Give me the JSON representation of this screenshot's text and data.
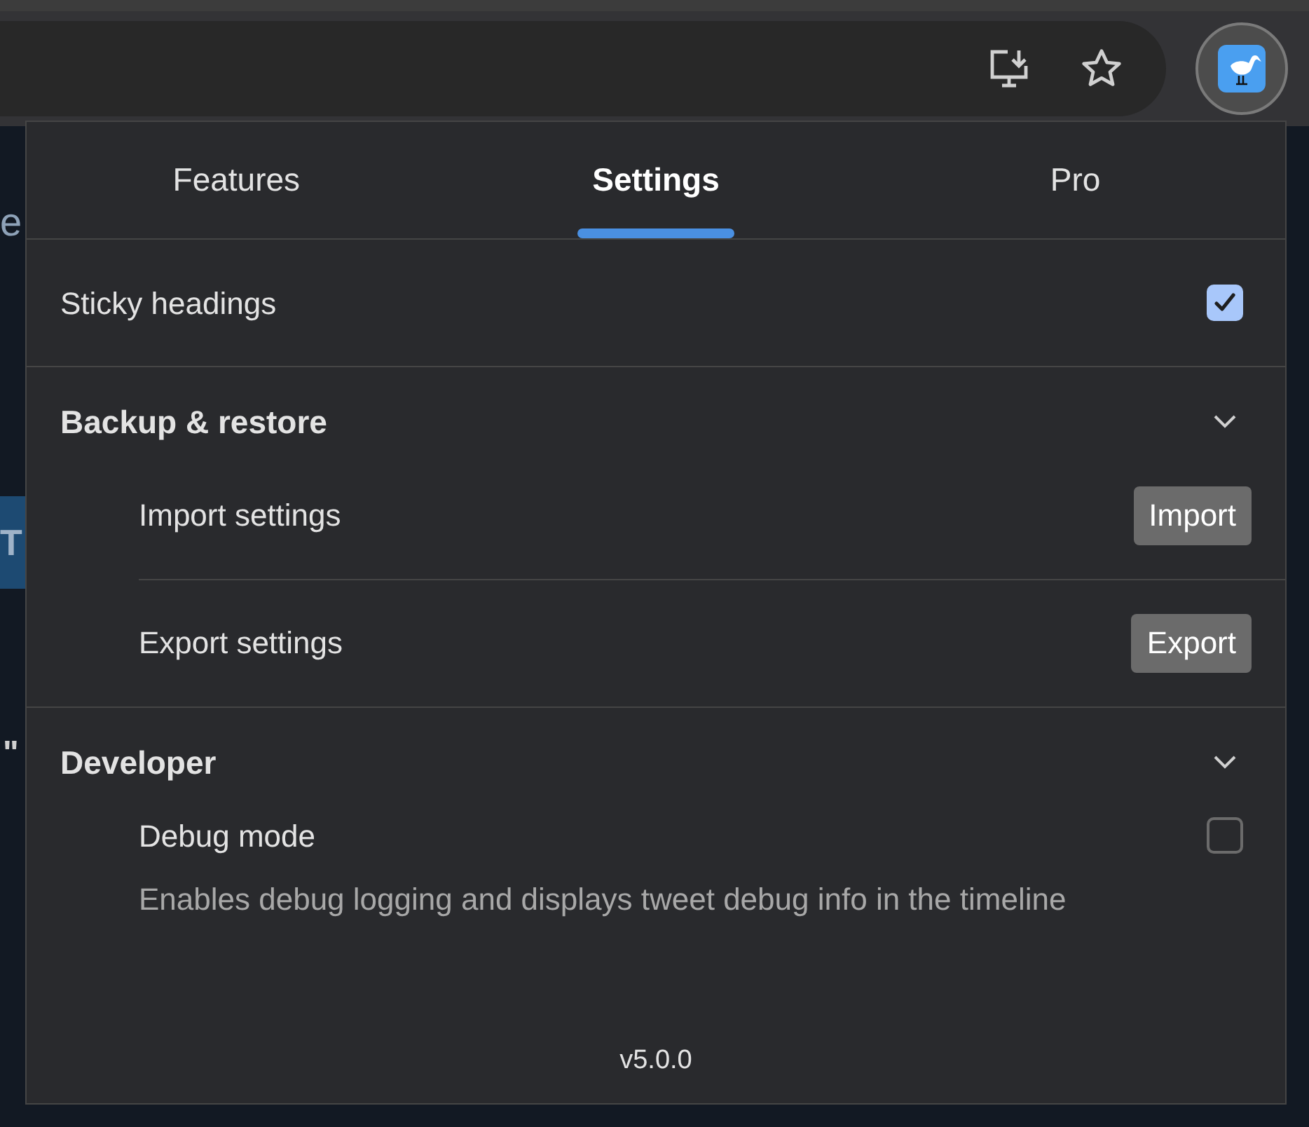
{
  "background_fragments": [
    {
      "text": "e"
    },
    {
      "text": "T"
    },
    {
      "text": "\""
    }
  ],
  "tabs": [
    {
      "label": "Features",
      "selected": false
    },
    {
      "label": "Settings",
      "selected": true
    },
    {
      "label": "Pro",
      "selected": false
    }
  ],
  "rows": [
    {
      "kind": "toggle",
      "label": "Sticky headings",
      "checked": true
    },
    {
      "kind": "section",
      "title": "Backup & restore",
      "expanded": true,
      "items": [
        {
          "kind": "action",
          "label": "Import settings",
          "button": "Import"
        },
        {
          "kind": "action",
          "label": "Export settings",
          "button": "Export"
        }
      ]
    },
    {
      "kind": "section",
      "title": "Developer",
      "expanded": true,
      "items": [
        {
          "kind": "toggle",
          "label": "Debug mode",
          "checked": false,
          "description": "Enables debug logging and displays tweet debug info in the timeline"
        }
      ]
    }
  ],
  "version": "v5.0.0"
}
